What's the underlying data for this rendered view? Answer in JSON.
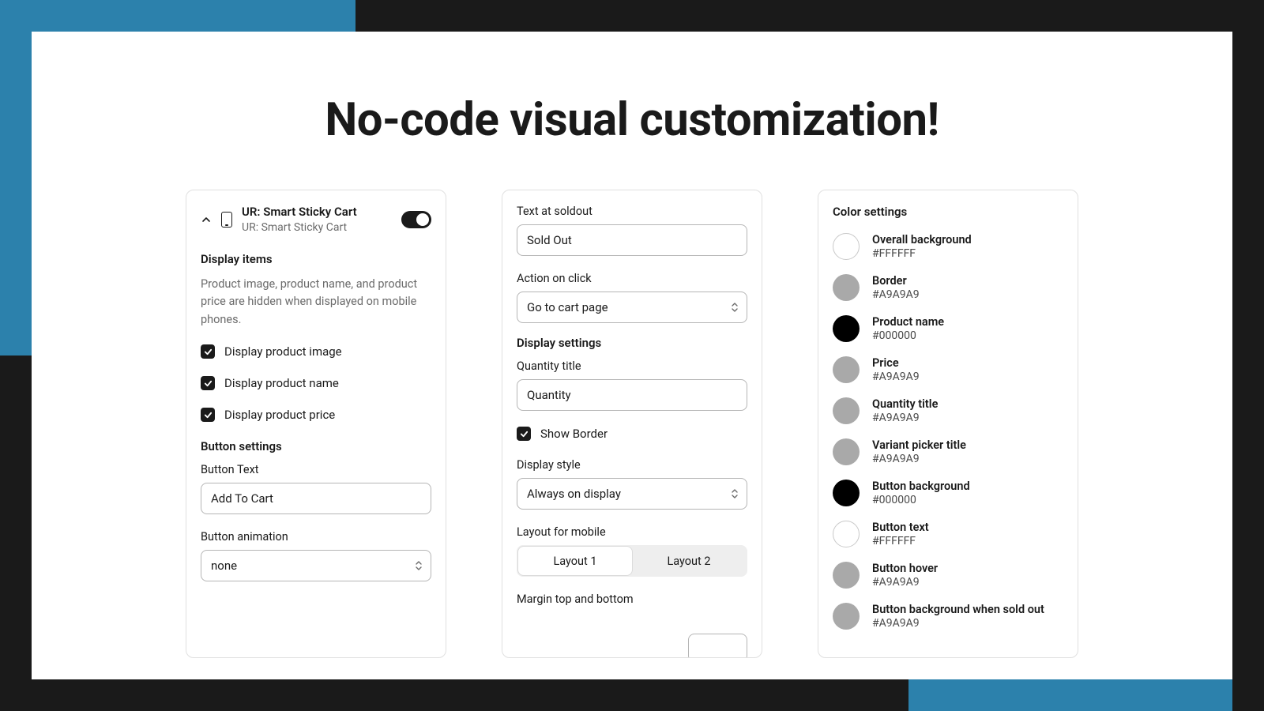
{
  "title": "No-code visual customization!",
  "panel1": {
    "app_title": "UR: Smart Sticky Cart",
    "app_sub": "UR: Smart Sticky Cart",
    "display_items_heading": "Display items",
    "display_items_help": "Product image, product name, and product price are hidden when displayed on mobile phones.",
    "cb_image": "Display product image",
    "cb_name": "Display product name",
    "cb_price": "Display product price",
    "button_settings_heading": "Button settings",
    "button_text_label": "Button Text",
    "button_text_value": "Add To Cart",
    "button_anim_label": "Button animation",
    "button_anim_value": "none"
  },
  "panel2": {
    "soldout_label": "Text at soldout",
    "soldout_value": "Sold Out",
    "action_label": "Action on click",
    "action_value": "Go to cart page",
    "display_settings_heading": "Display settings",
    "qty_label": "Quantity title",
    "qty_value": "Quantity",
    "show_border_label": "Show Border",
    "display_style_label": "Display style",
    "display_style_value": "Always on display",
    "layout_label": "Layout for mobile",
    "layout1": "Layout 1",
    "layout2": "Layout 2",
    "margin_label": "Margin top and bottom"
  },
  "panel3": {
    "heading": "Color settings",
    "colors": [
      {
        "name": "Overall background",
        "hex": "#FFFFFF",
        "swatch": "#FFFFFF"
      },
      {
        "name": "Border",
        "hex": "#A9A9A9",
        "swatch": "#A9A9A9"
      },
      {
        "name": "Product name",
        "hex": "#000000",
        "swatch": "#000000"
      },
      {
        "name": "Price",
        "hex": "#A9A9A9",
        "swatch": "#A9A9A9"
      },
      {
        "name": "Quantity title",
        "hex": "#A9A9A9",
        "swatch": "#A9A9A9"
      },
      {
        "name": "Variant picker title",
        "hex": "#A9A9A9",
        "swatch": "#A9A9A9"
      },
      {
        "name": "Button background",
        "hex": "#000000",
        "swatch": "#000000"
      },
      {
        "name": "Button text",
        "hex": "#FFFFFF",
        "swatch": "#FFFFFF"
      },
      {
        "name": "Button hover",
        "hex": "#A9A9A9",
        "swatch": "#A9A9A9"
      },
      {
        "name": "Button background when sold out",
        "hex": "#A9A9A9",
        "swatch": "#A9A9A9"
      }
    ]
  }
}
